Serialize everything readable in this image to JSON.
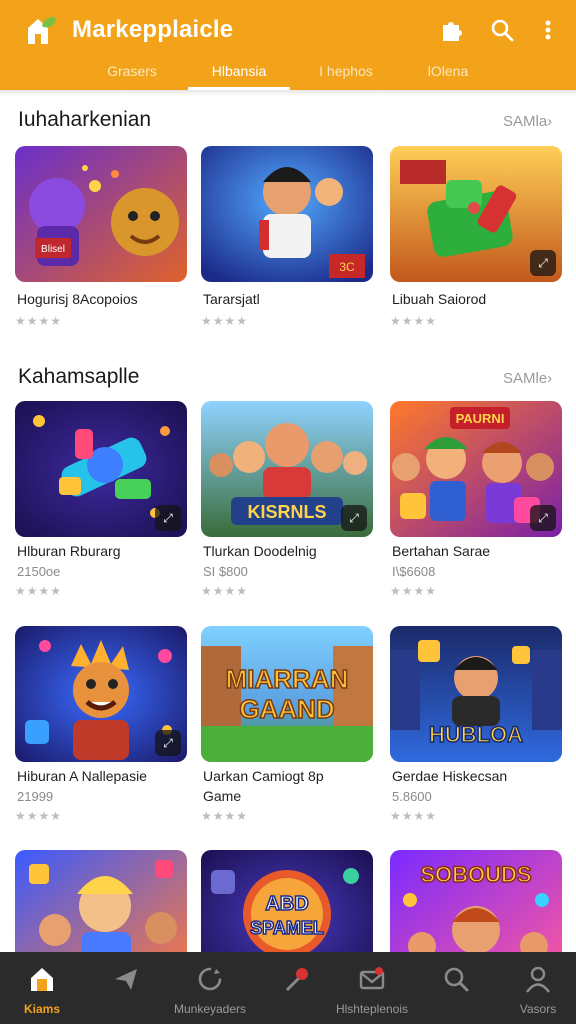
{
  "header": {
    "title": "Markepplaicle",
    "logo_icon": "house-leaf-logo",
    "actions": [
      {
        "icon": "puzzle-icon"
      },
      {
        "icon": "search-icon"
      },
      {
        "icon": "more-vert-icon"
      }
    ]
  },
  "tabs": [
    {
      "label": "Grasers"
    },
    {
      "label": "Hlbansia",
      "active": true
    },
    {
      "label": "I hephos"
    },
    {
      "label": "lOlena"
    }
  ],
  "sections": [
    {
      "title": "Iuhaharkenian",
      "see_all": "SAMla›",
      "cards": [
        {
          "name": "Hogurisj 8Acopoios",
          "price": "",
          "rating": "★★★★"
        },
        {
          "name": "Tararsjatl",
          "price": "",
          "rating": "★★★★"
        },
        {
          "name": "Libuah Saiorod",
          "price": "",
          "rating": "★★★★"
        }
      ]
    },
    {
      "title": "Kahamsaplle",
      "see_all": "SAMle›",
      "cards": [
        {
          "name": "Hlburan Rburarg",
          "price": "2150oe",
          "rating": "★★★★"
        },
        {
          "name": "Tlurkan Doodelnig",
          "price": "SI $800",
          "rating": "★★★★"
        },
        {
          "name": "Bertahan Sarae",
          "price": "I\\$6608",
          "rating": "★★★★"
        }
      ]
    },
    {
      "title": "",
      "see_all": "",
      "cards": [
        {
          "name": "Hiburan A Nallepasie",
          "price": "21999",
          "rating": "★★★★"
        },
        {
          "name": "Uarkan Camiogt 8p",
          "name2": "Game",
          "price": "",
          "rating": "★★★★"
        },
        {
          "name": "Gerdae Hiskecsan",
          "price": "5.8600",
          "rating": "★★★★"
        }
      ]
    }
  ],
  "thumb_text": {
    "c0_1": "Blisel",
    "c0_2": "3C",
    "c1_1": "KISRNLS",
    "c1_2": "PAURNI",
    "c2_1": "MIARRAN",
    "c2_2": "GAAND",
    "c2_3": "HUBLOA",
    "c3_1": "ABD",
    "c3_2": "SPAMEL",
    "c3_3": "SOBOUDS"
  },
  "bottom_nav": [
    {
      "label": "Kiams",
      "icon": "home-icon",
      "active": true
    },
    {
      "label": "",
      "icon": "send-icon"
    },
    {
      "label": "Munkeyaders",
      "icon": "refresh-icon"
    },
    {
      "label": "",
      "icon": "pin-icon"
    },
    {
      "label": "Hlshteplenois",
      "icon": "mail-icon"
    },
    {
      "label": "",
      "icon": "search-icon"
    },
    {
      "label": "Vasors",
      "icon": "person-icon"
    }
  ],
  "colors": {
    "primary": "#f2a31a",
    "nav_bg": "#2b2b2b",
    "nav_inactive": "#9a9a9a"
  }
}
